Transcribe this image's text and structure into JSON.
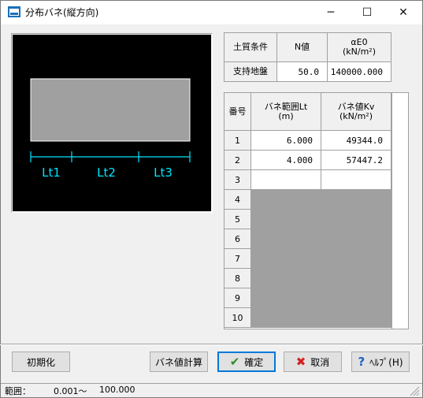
{
  "window": {
    "title": "分布バネ(縦方向)",
    "minimize_glyph": "─",
    "maximize_glyph": "☐",
    "close_glyph": "✕"
  },
  "preview": {
    "labels": [
      "Lt1",
      "Lt2",
      "Lt3"
    ],
    "colors": {
      "background": "#000000",
      "rect": "#a0a0a0",
      "rect_border": "#ffffff",
      "dim": "#00e5ff"
    }
  },
  "soil_table": {
    "headers": [
      "土質条件",
      "N値",
      "αE0\n(kN/m²)"
    ],
    "row_label": "支持地盤",
    "n_value": "50.0",
    "e0_value": "140000.000"
  },
  "spring_table": {
    "headers": [
      "番号",
      "バネ範囲Lt\n(m)",
      "バネ値Kv\n(kN/m²)"
    ],
    "rows": [
      {
        "no": "1",
        "lt": "6.000",
        "kv": "49344.0",
        "state": "filled"
      },
      {
        "no": "2",
        "lt": "4.000",
        "kv": "57447.2",
        "state": "filled"
      },
      {
        "no": "3",
        "lt": "",
        "kv": "",
        "state": "empty"
      },
      {
        "no": "4",
        "lt": "",
        "kv": "",
        "state": "disabled"
      },
      {
        "no": "5",
        "lt": "",
        "kv": "",
        "state": "disabled"
      },
      {
        "no": "6",
        "lt": "",
        "kv": "",
        "state": "disabled"
      },
      {
        "no": "7",
        "lt": "",
        "kv": "",
        "state": "disabled"
      },
      {
        "no": "8",
        "lt": "",
        "kv": "",
        "state": "disabled"
      },
      {
        "no": "9",
        "lt": "",
        "kv": "",
        "state": "disabled"
      },
      {
        "no": "10",
        "lt": "",
        "kv": "",
        "state": "disabled"
      }
    ]
  },
  "buttons": {
    "init": "初期化",
    "calc": "バネ値計算",
    "ok": "確定",
    "cancel": "取消",
    "help": "ﾍﾙﾌﾟ(H)",
    "ok_icon": "check-icon",
    "cancel_icon": "cross-icon",
    "help_icon": "question-icon",
    "ok_icon_color": "#2e8b2e",
    "cancel_icon_color": "#d42020",
    "help_icon_color": "#2060c0"
  },
  "status": {
    "label": "範囲：",
    "min": "0.001～",
    "max": "100.000"
  }
}
